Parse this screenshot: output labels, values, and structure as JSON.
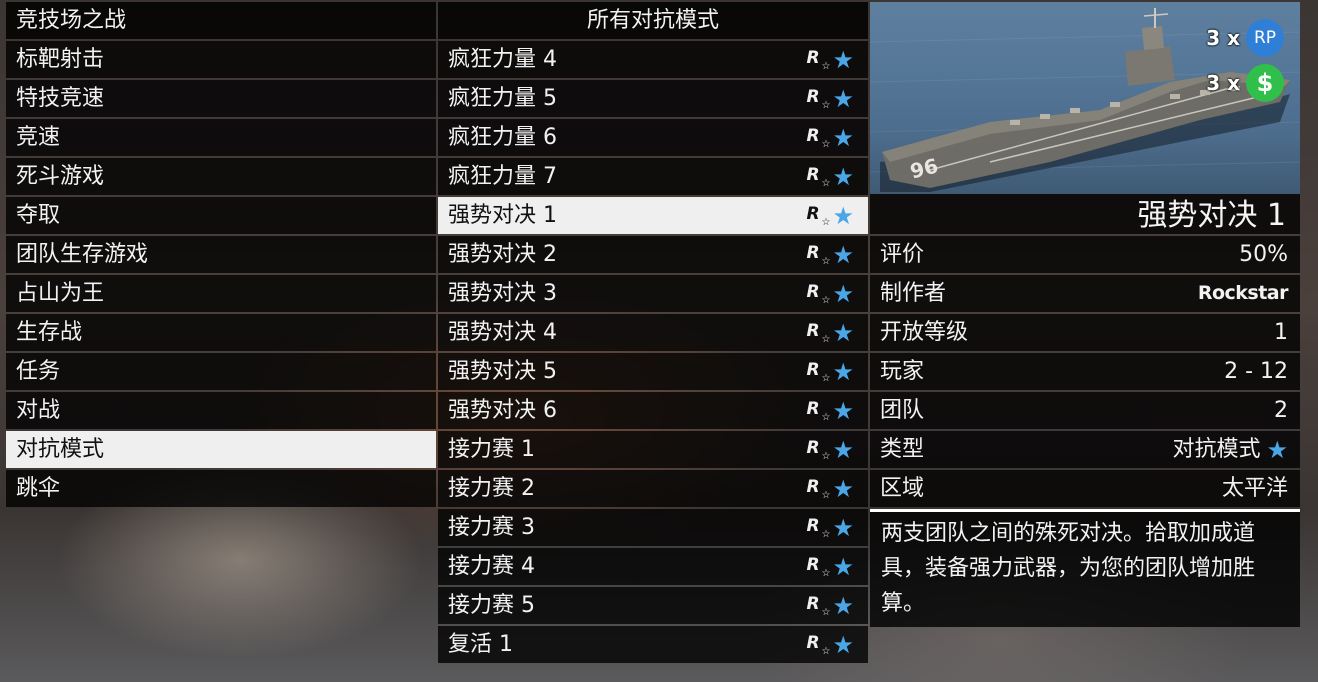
{
  "left_menu": {
    "items": [
      {
        "label": "竞技场之战",
        "selected": false
      },
      {
        "label": "标靶射击",
        "selected": false
      },
      {
        "label": "特技竞速",
        "selected": false
      },
      {
        "label": "竞速",
        "selected": false
      },
      {
        "label": "死斗游戏",
        "selected": false
      },
      {
        "label": "夺取",
        "selected": false
      },
      {
        "label": "团队生存游戏",
        "selected": false
      },
      {
        "label": "占山为王",
        "selected": false
      },
      {
        "label": "生存战",
        "selected": false
      },
      {
        "label": "任务",
        "selected": false
      },
      {
        "label": "对战",
        "selected": false
      },
      {
        "label": "对抗模式",
        "selected": true
      },
      {
        "label": "跳伞",
        "selected": false
      }
    ]
  },
  "mode_list": {
    "header": "所有对抗模式",
    "icon_r": "R",
    "items": [
      {
        "label": "疯狂力量 4",
        "selected": false
      },
      {
        "label": "疯狂力量 5",
        "selected": false
      },
      {
        "label": "疯狂力量 6",
        "selected": false
      },
      {
        "label": "疯狂力量 7",
        "selected": false
      },
      {
        "label": "强势对决 1",
        "selected": true
      },
      {
        "label": "强势对决 2",
        "selected": false
      },
      {
        "label": "强势对决 3",
        "selected": false
      },
      {
        "label": "强势对决 4",
        "selected": false
      },
      {
        "label": "强势对决 5",
        "selected": false
      },
      {
        "label": "强势对决 6",
        "selected": false
      },
      {
        "label": "接力赛 1",
        "selected": false
      },
      {
        "label": "接力赛 2",
        "selected": false
      },
      {
        "label": "接力赛 3",
        "selected": false
      },
      {
        "label": "接力赛 4",
        "selected": false
      },
      {
        "label": "接力赛 5",
        "selected": false
      },
      {
        "label": "复活 1",
        "selected": false
      }
    ]
  },
  "details": {
    "bonus_rp": {
      "mult": "3 x",
      "label": "RP"
    },
    "bonus_cash": {
      "mult": "3 x",
      "label": "$"
    },
    "thumbnail_icon": "aircraft-carrier",
    "hull_number": "96",
    "title": "强势对决 1",
    "rows": [
      {
        "key": "评价",
        "value": "50%"
      },
      {
        "key": "制作者",
        "value": "Rockstar"
      },
      {
        "key": "开放等级",
        "value": "1"
      },
      {
        "key": "玩家",
        "value": "2 - 12"
      },
      {
        "key": "团队",
        "value": "2"
      },
      {
        "key": "类型",
        "value": "对抗模式"
      },
      {
        "key": "区域",
        "value": "太平洋"
      }
    ],
    "description": "两支团队之间的殊死对决。拾取加成道具，装备强力武器，为您的团队增加胜算。"
  },
  "colors": {
    "accent_star": "#4aa6e6",
    "rp_circle": "#2f7fd6",
    "cash_circle": "#2fbf4a",
    "selected_row": "#efefef"
  }
}
